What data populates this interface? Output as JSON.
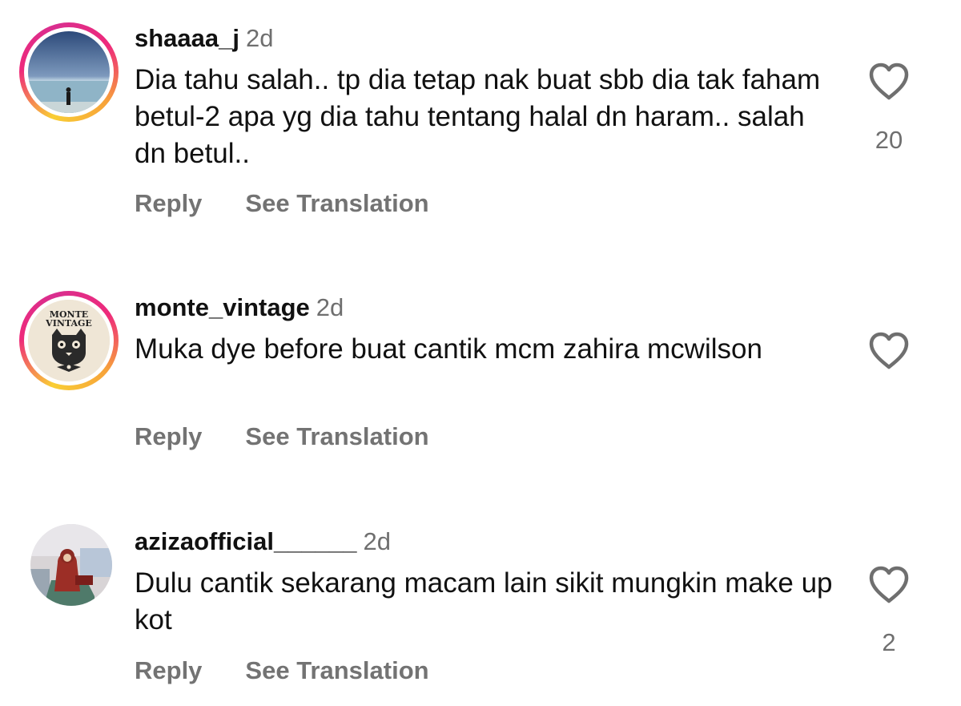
{
  "comments": [
    {
      "username": "shaaaa_j",
      "time": "2d",
      "text": "Dia tahu salah.. tp dia tetap nak buat sbb dia tak faham betul-2 apa yg dia tahu tentang halal dn haram.. salah dn betul..",
      "reply_label": "Reply",
      "translate_label": "See Translation",
      "likes": "20",
      "has_story_ring": true,
      "avatar_icon": "beach-photo"
    },
    {
      "username": "monte_vintage",
      "time": "2d",
      "text": "Muka dye before buat cantik mcm zahira mcwilson",
      "reply_label": "Reply",
      "translate_label": "See Translation",
      "likes": "",
      "has_story_ring": true,
      "avatar_icon": "cat-logo",
      "avatar_logo_text": [
        "MONTE",
        "VINTAGE"
      ]
    },
    {
      "username": "azizaofficial______",
      "time": "2d",
      "text": "Dulu cantik sekarang macam lain sikit mungkin make up kot",
      "reply_label": "Reply",
      "translate_label": "See Translation",
      "likes": "2",
      "has_story_ring": false,
      "avatar_icon": "person-photo"
    }
  ],
  "colors": {
    "text": "#111111",
    "secondary": "#737373",
    "ring_gradient": [
      "#f9ce34",
      "#ee2a7b",
      "#f7a23a"
    ]
  }
}
